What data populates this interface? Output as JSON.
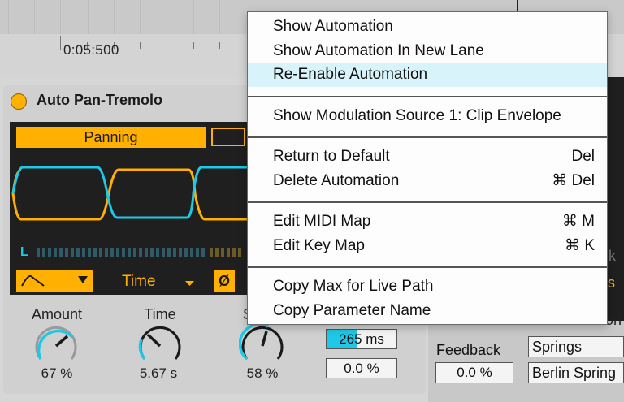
{
  "arrangement": {
    "time_marker": "0:05:500"
  },
  "device": {
    "name": "Auto Pan-Tremolo",
    "mode_label": "Panning",
    "meter_label": "L",
    "rate_mode": "Time",
    "phase_button": "Ø",
    "amount": {
      "label": "Amount",
      "value": "67 %"
    },
    "time": {
      "label": "Time",
      "value": "5.67 s"
    },
    "third_knob": {
      "label": "S",
      "value": "58 %"
    },
    "ms_field": "265 ms",
    "deg_field": "0.0 %"
  },
  "reverb": {
    "feedback_label": "Feedback",
    "feedback_value": "0.0 %",
    "dropdown1": "Springs",
    "dropdown2": "Berlin Spring",
    "partial_label": "on",
    "side_k": "k",
    "side_s": "s"
  },
  "menu": {
    "groups": [
      [
        {
          "label": "Show Automation",
          "shortcut": ""
        },
        {
          "label": "Show Automation In New Lane",
          "shortcut": ""
        },
        {
          "label": "Re-Enable Automation",
          "shortcut": "",
          "highlighted": true
        }
      ],
      [
        {
          "label": "Show Modulation Source 1: Clip Envelope",
          "shortcut": ""
        }
      ],
      [
        {
          "label": "Return to Default",
          "shortcut": "Del"
        },
        {
          "label": "Delete Automation",
          "shortcut": "⌘ Del"
        }
      ],
      [
        {
          "label": "Edit MIDI Map",
          "shortcut": "⌘ M"
        },
        {
          "label": "Edit Key Map",
          "shortcut": "⌘ K"
        }
      ],
      [
        {
          "label": "Copy Max for Live Path",
          "shortcut": ""
        },
        {
          "label": "Copy Parameter Name",
          "shortcut": ""
        }
      ]
    ]
  },
  "colors": {
    "accent": "#ffb000",
    "cyan": "#1ec8e6",
    "highlight": "#d8f4fa"
  }
}
